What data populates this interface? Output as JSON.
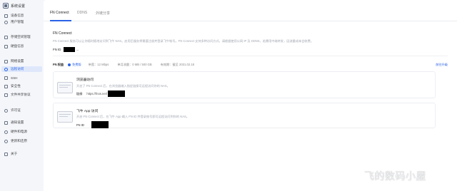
{
  "app": {
    "title": "系统设置"
  },
  "sidebar": {
    "items": [
      {
        "label": "设备信息",
        "icon": "monitor-icon",
        "active": false
      },
      {
        "label": "用户管理",
        "icon": "user-icon",
        "active": false
      },
      {
        "label": "存储空间管理",
        "icon": "storage-icon",
        "active": false
      },
      {
        "label": "硬盘信息",
        "icon": "disk-icon",
        "active": false
      },
      {
        "label": "网络设置",
        "icon": "network-icon",
        "active": false
      },
      {
        "label": "远程访问",
        "icon": "remote-icon",
        "active": true
      },
      {
        "label": "SSH",
        "icon": "terminal-icon",
        "active": false
      },
      {
        "label": "安全性",
        "icon": "shield-icon",
        "active": false
      },
      {
        "label": "文件共享协议",
        "icon": "share-icon",
        "active": false
      },
      {
        "label": "许可证",
        "icon": "license-icon",
        "active": false
      },
      {
        "label": "通知设置",
        "icon": "bell-icon",
        "active": false
      },
      {
        "label": "硬件和电源",
        "icon": "power-icon",
        "active": false
      },
      {
        "label": "更新和还原",
        "icon": "update-icon",
        "active": false
      },
      {
        "label": "关于",
        "icon": "info-icon",
        "active": false
      }
    ]
  },
  "tabs": [
    {
      "label": "FN Connect",
      "active": true
    },
    {
      "label": "DDNS",
      "active": false
    },
    {
      "label": "外链分享",
      "active": false
    }
  ],
  "fn_connect": {
    "title": "FN Connect",
    "description": "FN Connect 服务可以让你随时随地访问到飞牛 NAS。启用后服务将需要注册并登录飞牛帐号。FN Connect 支持多种访问方式，请根据使用公网 IP 及 DDNS，若需用中继转发，因流量成本会收费。",
    "id_label": "FN ID",
    "id_suffix": "...",
    "enabled": true
  },
  "plan": {
    "label": "FN 权益",
    "badge": "免费版",
    "bandwidth": "带宽：12 Mbps",
    "monthly_traffic": "单月流量：0 MB / 500 GB",
    "expiry": "有效期：截至 2031.02.18",
    "upgrade_label": "前往升级"
  },
  "browser_access": {
    "title": "浏览器访问",
    "description": "开启了 FN Connect 后，在浏览器输入指定链接可远程访问你的 NAS。",
    "link_label": "链接",
    "link_value": "https://fnos.net/"
  },
  "app_access": {
    "title": "飞牛 App 访问",
    "description": "开启 FN Connect 后，在飞牛 App 输入 FN ID 并登录账号即可远程访问到你的 NAS。",
    "id_label": "FN ID"
  },
  "watermark": "飞的数码小屋",
  "colors": {
    "accent": "#2a62e6",
    "active_bg": "#dfe8fb"
  }
}
